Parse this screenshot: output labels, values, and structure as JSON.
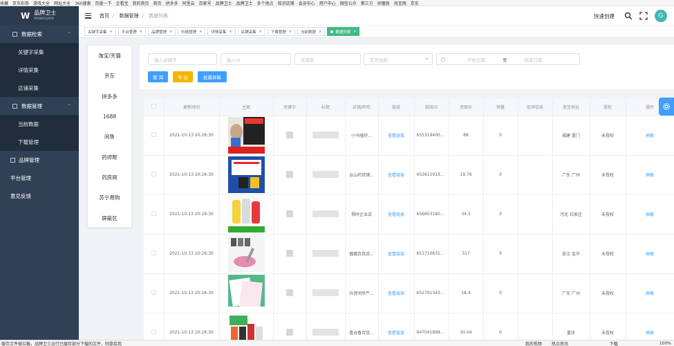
{
  "bookmarks": [
    "收藏",
    "京东彩券",
    "游戏大全",
    "网址大全",
    "360搜索",
    "百度一下",
    "企看宝",
    "我的首页",
    "首页",
    "拼多多",
    "阿里云",
    "百家号",
    "品牌卫士",
    "品牌卫士",
    "多个地点",
    "知识店铺",
    "会员中心",
    "用户中心",
    "微信公众",
    "第三方",
    "异瞳商",
    "淘宝网",
    "京东"
  ],
  "sidebar": {
    "logo_title": "品牌卫士",
    "logo_sub": "BRANDGUARD",
    "logo_mark": "W",
    "items": [
      {
        "label": "数据检索",
        "type": "grp",
        "icon": "search-list-icon",
        "open": true
      },
      {
        "label": "关键字采集",
        "type": "sub"
      },
      {
        "label": "详情采集",
        "type": "sub"
      },
      {
        "label": "店铺采集",
        "type": "sub"
      },
      {
        "label": "数据管理",
        "type": "grp",
        "icon": "data-icon",
        "open": true
      },
      {
        "label": "当前数据",
        "type": "sub"
      },
      {
        "label": "下载管理",
        "type": "sub"
      },
      {
        "label": "品牌管理",
        "type": "top",
        "icon": "brand-icon"
      },
      {
        "label": "平台管理",
        "type": "top"
      },
      {
        "label": "意见反馈",
        "type": "top"
      }
    ]
  },
  "header": {
    "breadcrumb": [
      "首页",
      "数据管理",
      "数据列表"
    ],
    "quick_create": "快速创建",
    "avatar": "G"
  },
  "tags": [
    {
      "label": "关键字采集"
    },
    {
      "label": "平台管理"
    },
    {
      "label": "品牌管理"
    },
    {
      "label": "价格管理"
    },
    {
      "label": "详情采集"
    },
    {
      "label": "店铺采集"
    },
    {
      "label": "下载管理"
    },
    {
      "label": "当前数据"
    },
    {
      "label": "数据列表",
      "active": true
    }
  ],
  "platforms": [
    "淘宝/天猫",
    "京东",
    "拼多多",
    "1688",
    "闲鱼",
    "药师帮",
    "药房网",
    "苏宁易购",
    "屏蔽区"
  ],
  "filters": {
    "keyword": "输入关键字",
    "link": "输入id",
    "shop": "店铺名",
    "auth": "是否授权",
    "start": "开始日期",
    "to": "至",
    "end": "结束日期"
  },
  "buttons": {
    "query": "查 询",
    "export": "导 出",
    "block": "批量屏蔽"
  },
  "colors": {
    "sidebar": "#304156",
    "primary": "#409eff",
    "export": "#f5b400",
    "active_tag": "#42b983"
  },
  "table": {
    "headers": [
      "",
      "更新时间",
      "主图",
      "关键字",
      "标题",
      "店铺/旺旺",
      "链接",
      "链接ID",
      "页面价",
      "销量",
      "促销信息",
      "发货地址",
      "授权",
      "操作"
    ],
    "rows": [
      {
        "time": "2021-10-13 20:26:30",
        "shop": "小马嗑好...",
        "link": "查看链接",
        "id": "6553194003...",
        "price": "88",
        "sales": "0",
        "addr": "福建 厦门",
        "auth": "未授权",
        "op": "屏蔽"
      },
      {
        "time": "2021-10-13 20:26:30",
        "shop": "云山药货铺...",
        "link": "查看链接",
        "id": "6536119133...",
        "price": "19.76",
        "sales": "0",
        "addr": "广东 广州",
        "auth": "未授权",
        "op": "屏蔽"
      },
      {
        "time": "2021-10-13 20:26:30",
        "shop": "得时企业店",
        "link": "查看链接",
        "id": "6566031801...",
        "price": "34.5",
        "sales": "0",
        "addr": "河北 石家庄",
        "auth": "未授权",
        "op": "屏蔽"
      },
      {
        "time": "2021-10-13 20:26:30",
        "shop": "璐璐百货店...",
        "link": "查看链接",
        "id": "6517106315...",
        "price": "317",
        "sales": "0",
        "addr": "浙江 金华",
        "auth": "未授权",
        "op": "屏蔽"
      },
      {
        "time": "2021-10-13 20:26:30",
        "shop": "抖音同步严...",
        "link": "查看链接",
        "id": "6527913437...",
        "price": "18.4",
        "sales": "0",
        "addr": "广东 广州",
        "auth": "未授权",
        "op": "屏蔽"
      },
      {
        "time": "2021-10-13 20:26:30",
        "shop": "喜谷香百货...",
        "link": "查看链接",
        "id": "6470418983...",
        "price": "30.04",
        "sales": "0",
        "addr": "重庆",
        "auth": "未授权",
        "op": "屏蔽"
      }
    ]
  },
  "status": {
    "left": "缓存文件被拦截，品牌卫士运行已缓存部分下载的文件，则拿给我",
    "right": [
      "我的视频",
      "热点资讯",
      "下载",
      "100%"
    ]
  }
}
